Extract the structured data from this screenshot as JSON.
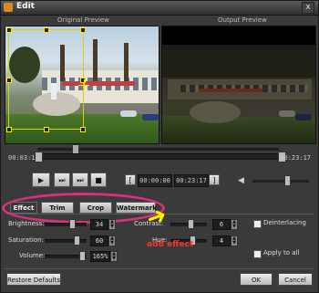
{
  "window": {
    "title": "Edit",
    "close_label": "x"
  },
  "preview": {
    "original_label": "Original Preview",
    "output_label": "Output Preview"
  },
  "timeline": {
    "start_time": "00:03:12",
    "end_time": "00:23:17"
  },
  "controls": {
    "play_glyph": "▶",
    "next_glyph": "⏭",
    "step_glyph": "⏭",
    "stop_glyph": "■",
    "mark_in_glyph": "[",
    "mark_out_glyph": "]",
    "start_box": "00:00:00",
    "end_box": "00:23:17",
    "volume_glyph": "◀"
  },
  "tabs": [
    {
      "label": "Effect",
      "active": true
    },
    {
      "label": "Trim",
      "active": false
    },
    {
      "label": "Crop",
      "active": false
    },
    {
      "label": "Watermark",
      "active": false
    }
  ],
  "adjustments": {
    "brightness": {
      "label": "Brightness:",
      "value": "34"
    },
    "saturation": {
      "label": "Saturation:",
      "value": "60"
    },
    "volume": {
      "label": "Volume:",
      "value": "165%"
    },
    "contrast": {
      "label": "Contrast:",
      "value": "6"
    },
    "hue": {
      "label": "Hue:",
      "value": "4"
    },
    "deinterlacing_label": "Deinterlacing",
    "apply_all_label": "Apply to all"
  },
  "annotation": {
    "text": "add effect"
  },
  "footer": {
    "restore_label": "Restore Defaults",
    "ok_label": "OK",
    "cancel_label": "Cancel"
  },
  "colors": {
    "highlight_ellipse": "#d8307a",
    "arrow": "#ffee00",
    "annotation": "#ff3030",
    "crop_frame": "#ddd000"
  },
  "icons": [
    "app-icon",
    "close-icon",
    "play-icon",
    "next-frame-icon",
    "step-icon",
    "stop-icon",
    "mark-in-icon",
    "mark-out-icon",
    "speaker-icon",
    "yellow-arrow"
  ]
}
